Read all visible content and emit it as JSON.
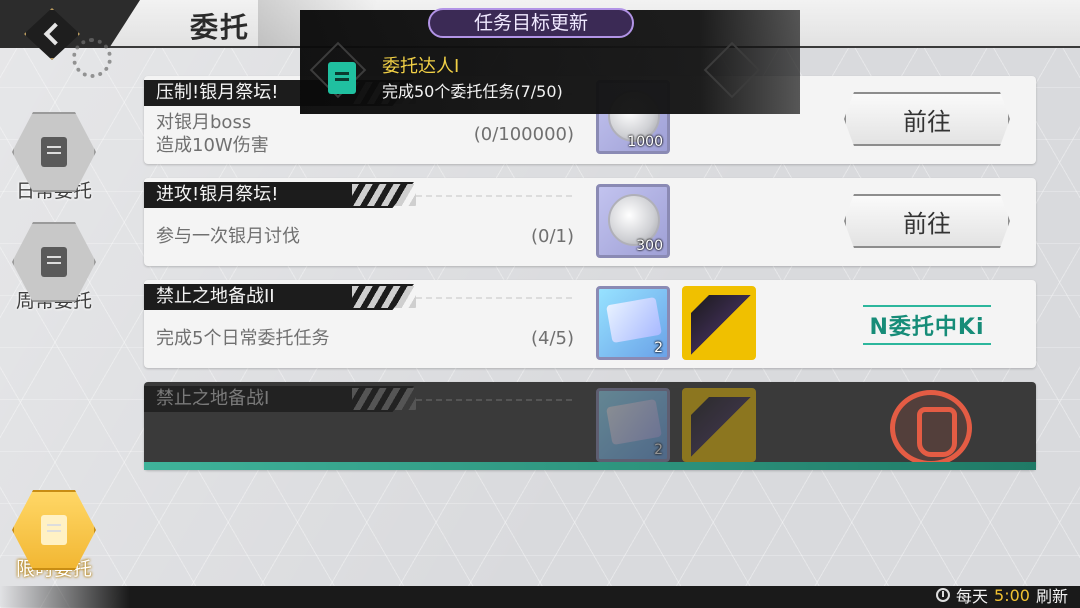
{
  "header": {
    "title": "委托"
  },
  "notification": {
    "tab_label": "任务目标更新",
    "title": "委托达人I",
    "desc": "完成50个委托任务(7/50)"
  },
  "sidebar": {
    "items": [
      {
        "label": "日常委托",
        "active": false
      },
      {
        "label": "周常委托",
        "active": false
      },
      {
        "label": "限时委托",
        "active": true
      }
    ]
  },
  "tasks": [
    {
      "name": "压制!银月祭坛!",
      "desc_line1": "对银月boss",
      "desc_line2": "造成10W伤害",
      "progress": "(0/100000)",
      "rewards": [
        {
          "type": "silver-coin",
          "qty": "1000"
        }
      ],
      "action_label": "前往"
    },
    {
      "name": "进攻!银月祭坛!",
      "desc_line1": "参与一次银月讨伐",
      "progress": "(0/1)",
      "rewards": [
        {
          "type": "silver-coin",
          "qty": "300"
        }
      ],
      "action_label": "前往"
    },
    {
      "name": "禁止之地备战II",
      "desc_line1": "完成5个日常委托任务",
      "progress": "(4/5)",
      "rewards": [
        {
          "type": "map-item",
          "qty": "2"
        },
        {
          "type": "portrait-fragment"
        }
      ],
      "status_label": "N委托中Ki"
    },
    {
      "name": "禁止之地备战I",
      "rewards": [
        {
          "type": "map-item",
          "qty": "2"
        },
        {
          "type": "portrait-fragment"
        }
      ],
      "status": "completed"
    }
  ],
  "footer": {
    "prefix": "每天",
    "time": "5:00",
    "suffix": "刷新"
  }
}
